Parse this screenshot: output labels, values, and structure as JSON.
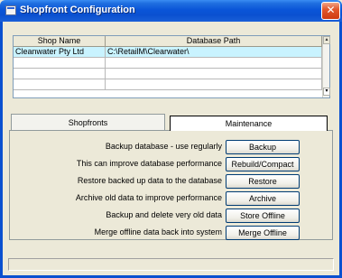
{
  "window": {
    "title": "Shopfront Configuration",
    "close_glyph": "✕"
  },
  "grid": {
    "columns": [
      "Shop Name",
      "Database Path"
    ],
    "rows": [
      [
        "Cleanwater Pty Ltd",
        "C:\\RetailM\\Clearwater\\"
      ],
      [
        "",
        ""
      ],
      [
        "",
        ""
      ],
      [
        "",
        ""
      ],
      [
        "",
        ""
      ]
    ],
    "selected_row": 0,
    "scroll_up_glyph": "▴",
    "scroll_down_glyph": "▾"
  },
  "tabs": {
    "items": [
      "Shopfronts",
      "Maintenance"
    ],
    "active": "Maintenance"
  },
  "maintenance": {
    "actions": [
      {
        "description": "Backup database - use regularly",
        "button": "Backup"
      },
      {
        "description": "This can improve database performance",
        "button": "Rebuild/Compact"
      },
      {
        "description": "Restore backed up data to the database",
        "button": "Restore"
      },
      {
        "description": "Archive old data to improve performance",
        "button": "Archive"
      },
      {
        "description": "Backup and delete very old data",
        "button": "Store Offline"
      },
      {
        "description": "Merge offline data back into system",
        "button": "Merge Offline"
      }
    ]
  },
  "status": {
    "text": ""
  }
}
